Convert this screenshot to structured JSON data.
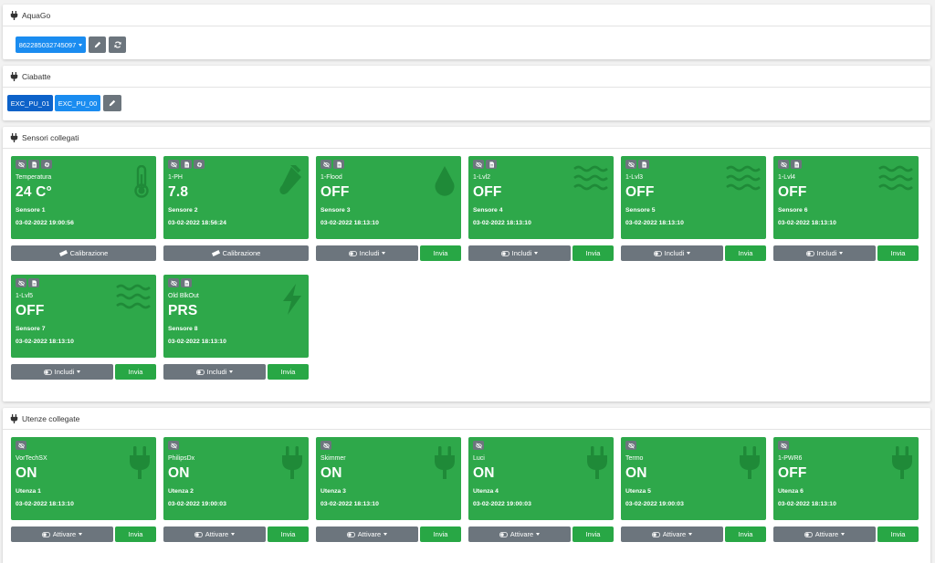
{
  "aquago": {
    "title": "AquaGo",
    "device_id": "862285032745097"
  },
  "ciabatte": {
    "title": "Ciabatte",
    "buttons": [
      "EXC_PU_01",
      "EXC_PU_00"
    ]
  },
  "sensori": {
    "title": "Sensori collegati",
    "tiles": [
      {
        "name": "Temperatura",
        "value": "24 C°",
        "sub": "Sensore 1",
        "date": "03-02-2022 19:00:56",
        "icon": "thermometer-icon",
        "tools": [
          "eye-slash-icon",
          "file-icon",
          "gear-icon"
        ],
        "action": "Calibrazione"
      },
      {
        "name": "1-PH",
        "value": "7.8",
        "sub": "Sensore 2",
        "date": "03-02-2022 18:56:24",
        "icon": "test-tube-icon",
        "tools": [
          "eye-slash-icon",
          "file-icon",
          "gear-icon"
        ],
        "action": "Calibrazione"
      },
      {
        "name": "1-Flood",
        "value": "OFF",
        "sub": "Sensore 3",
        "date": "03-02-2022 18:13:10",
        "icon": "drop-icon",
        "tools": [
          "eye-slash-icon",
          "file-icon"
        ],
        "action": "Includi",
        "send": "Invia"
      },
      {
        "name": "1-Lvl2",
        "value": "OFF",
        "sub": "Sensore 4",
        "date": "03-02-2022 18:13:10",
        "icon": "water-icon",
        "tools": [
          "eye-slash-icon",
          "file-icon"
        ],
        "action": "Includi",
        "send": "Invia"
      },
      {
        "name": "1-Lvl3",
        "value": "OFF",
        "sub": "Sensore 5",
        "date": "03-02-2022 18:13:10",
        "icon": "water-icon",
        "tools": [
          "eye-slash-icon",
          "file-icon"
        ],
        "action": "Includi",
        "send": "Invia"
      },
      {
        "name": "1-Lvl4",
        "value": "OFF",
        "sub": "Sensore 6",
        "date": "03-02-2022 18:13:10",
        "icon": "water-icon",
        "tools": [
          "eye-slash-icon",
          "file-icon"
        ],
        "action": "Includi",
        "send": "Invia"
      },
      {
        "name": "1-Lvl5",
        "value": "OFF",
        "sub": "Sensore 7",
        "date": "03-02-2022 18:13:10",
        "icon": "water-icon",
        "tools": [
          "eye-slash-icon",
          "file-icon"
        ],
        "action": "Includi",
        "send": "Invia"
      },
      {
        "name": "Old BlkOut",
        "value": "PRS",
        "sub": "Sensore 8",
        "date": "03-02-2022 18:13:10",
        "icon": "bolt-icon",
        "tools": [
          "eye-slash-icon",
          "file-icon"
        ],
        "action": "Includi",
        "send": "Invia"
      }
    ]
  },
  "utenze": {
    "title": "Utenze collegate",
    "tiles": [
      {
        "name": "VorTechSX",
        "value": "ON",
        "sub": "Utenza 1",
        "date": "03-02-2022 18:13:10",
        "action": "Attivare",
        "send": "Invia"
      },
      {
        "name": "PhilipsDx",
        "value": "ON",
        "sub": "Utenza 2",
        "date": "03-02-2022 19:00:03",
        "action": "Attivare",
        "send": "Invia"
      },
      {
        "name": "Skimmer",
        "value": "ON",
        "sub": "Utenza 3",
        "date": "03-02-2022 18:13:10",
        "action": "Attivare",
        "send": "Invia"
      },
      {
        "name": "Luci",
        "value": "ON",
        "sub": "Utenza 4",
        "date": "03-02-2022 19:00:03",
        "action": "Attivare",
        "send": "Invia"
      },
      {
        "name": "Termo",
        "value": "ON",
        "sub": "Utenza 5",
        "date": "03-02-2022 19:00:03",
        "action": "Attivare",
        "send": "Invia"
      },
      {
        "name": "1-PWR6",
        "value": "OFF",
        "sub": "Utenza 6",
        "date": "03-02-2022 18:13:10",
        "action": "Attivare",
        "send": "Invia"
      }
    ]
  },
  "colors": {
    "tile": "#2ea84a",
    "gray": "#6c757d",
    "green": "#28a745",
    "blue": "#1a8cf0",
    "dark_blue": "#0d62c9"
  }
}
